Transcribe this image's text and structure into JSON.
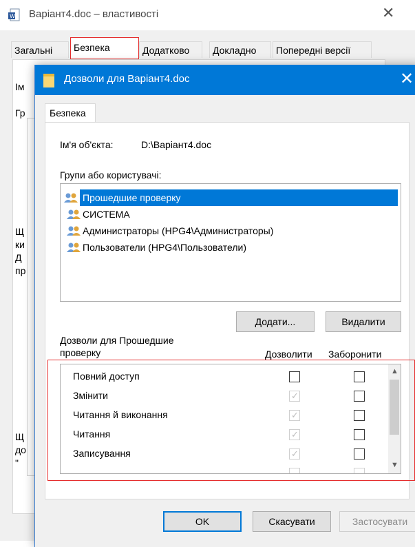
{
  "background_window": {
    "title": "Варіант4.doc – властивості",
    "close_glyph": "✕",
    "tabs": [
      "Загальні",
      "Безпека",
      "Додатково",
      "Докладно",
      "Попередні версії"
    ],
    "active_tab": "Безпека",
    "left_fragments": [
      "Ім",
      "Гр",
      "Щ",
      "ки",
      "Д",
      "пр",
      "Щ",
      "до",
      "\""
    ]
  },
  "dialog": {
    "title": "Дозволи для Варіант4.doc",
    "close_glyph": "✕",
    "tab": "Безпека",
    "object_name_label": "Ім'я об'єкта:",
    "object_name_value": "D:\\Варіант4.doc",
    "groups_label": "Групи або користувачі:",
    "groups": [
      {
        "name": "Прошедшие проверку",
        "selected": true
      },
      {
        "name": "СИСТЕМА",
        "selected": false
      },
      {
        "name": "Администраторы (HPG4\\Администраторы)",
        "selected": false
      },
      {
        "name": "Пользователи (HPG4\\Пользователи)",
        "selected": false
      }
    ],
    "add_button": "Додати...",
    "remove_button": "Видалити",
    "permissions_label_line1": "Дозволи для Прошедшие",
    "permissions_label_line2": "проверку",
    "allow_header": "Дозволити",
    "deny_header": "Заборонити",
    "permissions": [
      {
        "name": "Повний доступ",
        "allow": false,
        "allow_disabled": false,
        "deny": false
      },
      {
        "name": "Змінити",
        "allow": true,
        "allow_disabled": true,
        "deny": false
      },
      {
        "name": "Читання й виконання",
        "allow": true,
        "allow_disabled": true,
        "deny": false
      },
      {
        "name": "Читання",
        "allow": true,
        "allow_disabled": true,
        "deny": false
      },
      {
        "name": "Записування",
        "allow": true,
        "allow_disabled": true,
        "deny": false
      }
    ],
    "ok_button": "OK",
    "cancel_button": "Скасувати",
    "apply_button": "Застосувати"
  },
  "colors": {
    "accent": "#0078d7",
    "highlight_box": "#e52d2d"
  },
  "icons": {
    "file": "doc-file-icon",
    "folder": "folder-icon",
    "users": "users-group-icon"
  }
}
